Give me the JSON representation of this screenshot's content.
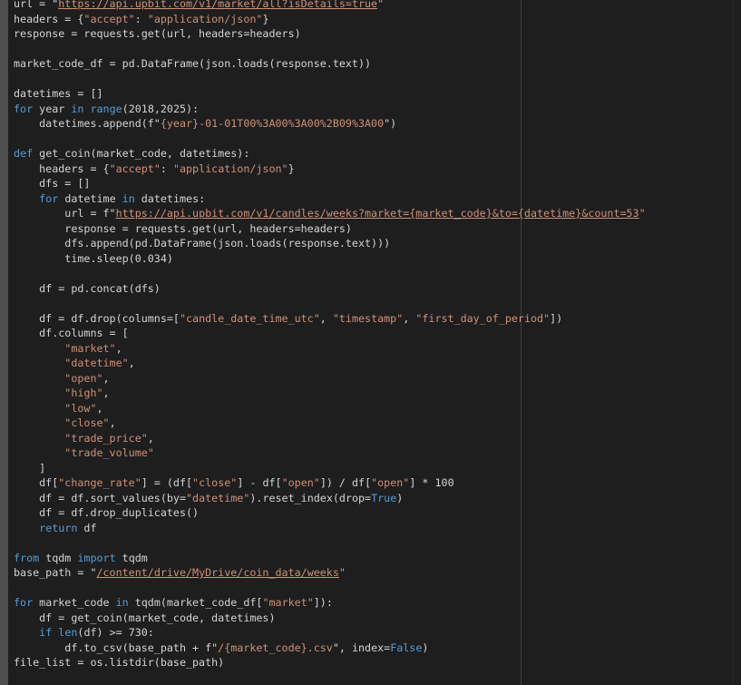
{
  "editor": {
    "lines": [
      [
        {
          "t": "url = \"",
          "c": ""
        },
        {
          "t": "https://api.upbit.com/v1/market/all?isDetails=true",
          "c": "url"
        },
        {
          "t": "\"",
          "c": "str"
        }
      ],
      [
        {
          "t": "headers = {",
          "c": ""
        },
        {
          "t": "\"accept\"",
          "c": "str"
        },
        {
          "t": ": ",
          "c": ""
        },
        {
          "t": "\"application/json\"",
          "c": "str"
        },
        {
          "t": "}",
          "c": ""
        }
      ],
      [
        {
          "t": "response = requests.get(url, headers=headers)",
          "c": ""
        }
      ],
      [],
      [
        {
          "t": "market_code_df = pd.DataFrame(json.loads(response.text))",
          "c": ""
        }
      ],
      [],
      [
        {
          "t": "datetimes = []",
          "c": ""
        }
      ],
      [
        {
          "t": "for",
          "c": "kw"
        },
        {
          "t": " year ",
          "c": ""
        },
        {
          "t": "in",
          "c": "kw"
        },
        {
          "t": " ",
          "c": ""
        },
        {
          "t": "range",
          "c": "kw"
        },
        {
          "t": "(2018,2025):",
          "c": ""
        }
      ],
      [
        {
          "t": "    datetimes.append(f\"",
          "c": ""
        },
        {
          "t": "{year}-01-01T00%3A00%3A00%2B09%3A00",
          "c": "str"
        },
        {
          "t": "\")",
          "c": ""
        }
      ],
      [],
      [
        {
          "t": "def",
          "c": "kw"
        },
        {
          "t": " get_coin(market_code, datetimes):",
          "c": ""
        }
      ],
      [
        {
          "t": "    headers = {",
          "c": ""
        },
        {
          "t": "\"accept\"",
          "c": "str"
        },
        {
          "t": ": ",
          "c": ""
        },
        {
          "t": "\"application/json\"",
          "c": "str"
        },
        {
          "t": "}",
          "c": ""
        }
      ],
      [
        {
          "t": "    dfs = []",
          "c": ""
        }
      ],
      [
        {
          "t": "    ",
          "c": ""
        },
        {
          "t": "for",
          "c": "kw"
        },
        {
          "t": " datetime ",
          "c": ""
        },
        {
          "t": "in",
          "c": "kw"
        },
        {
          "t": " datetimes:",
          "c": ""
        }
      ],
      [
        {
          "t": "        url = f\"",
          "c": ""
        },
        {
          "t": "https://api.upbit.com/v1/candles/weeks?market={market_code}&to={datetime}&count=53",
          "c": "url"
        },
        {
          "t": "\"",
          "c": "str"
        }
      ],
      [
        {
          "t": "        response = requests.get(url, headers=headers)",
          "c": ""
        }
      ],
      [
        {
          "t": "        dfs.append(pd.DataFrame(json.loads(response.text)))",
          "c": ""
        }
      ],
      [
        {
          "t": "        time.sleep(0.034)",
          "c": ""
        }
      ],
      [],
      [
        {
          "t": "    df = pd.concat(dfs)",
          "c": ""
        }
      ],
      [],
      [
        {
          "t": "    df = df.drop(columns=[",
          "c": ""
        },
        {
          "t": "\"candle_date_time_utc\"",
          "c": "str"
        },
        {
          "t": ", ",
          "c": ""
        },
        {
          "t": "\"timestamp\"",
          "c": "str"
        },
        {
          "t": ", ",
          "c": ""
        },
        {
          "t": "\"first_day_of_period\"",
          "c": "str"
        },
        {
          "t": "])",
          "c": ""
        }
      ],
      [
        {
          "t": "    df.columns = [",
          "c": ""
        }
      ],
      [
        {
          "t": "        ",
          "c": ""
        },
        {
          "t": "\"market\"",
          "c": "str"
        },
        {
          "t": ",",
          "c": ""
        }
      ],
      [
        {
          "t": "        ",
          "c": ""
        },
        {
          "t": "\"datetime\"",
          "c": "str"
        },
        {
          "t": ",",
          "c": ""
        }
      ],
      [
        {
          "t": "        ",
          "c": ""
        },
        {
          "t": "\"open\"",
          "c": "str"
        },
        {
          "t": ",",
          "c": ""
        }
      ],
      [
        {
          "t": "        ",
          "c": ""
        },
        {
          "t": "\"high\"",
          "c": "str"
        },
        {
          "t": ",",
          "c": ""
        }
      ],
      [
        {
          "t": "        ",
          "c": ""
        },
        {
          "t": "\"low\"",
          "c": "str"
        },
        {
          "t": ",",
          "c": ""
        }
      ],
      [
        {
          "t": "        ",
          "c": ""
        },
        {
          "t": "\"close\"",
          "c": "str"
        },
        {
          "t": ",",
          "c": ""
        }
      ],
      [
        {
          "t": "        ",
          "c": ""
        },
        {
          "t": "\"trade_price\"",
          "c": "str"
        },
        {
          "t": ",",
          "c": ""
        }
      ],
      [
        {
          "t": "        ",
          "c": ""
        },
        {
          "t": "\"trade_volume\"",
          "c": "str"
        }
      ],
      [
        {
          "t": "    ]",
          "c": ""
        }
      ],
      [
        {
          "t": "    df[",
          "c": ""
        },
        {
          "t": "\"change_rate\"",
          "c": "str"
        },
        {
          "t": "] = (df[",
          "c": ""
        },
        {
          "t": "\"close\"",
          "c": "str"
        },
        {
          "t": "] - df[",
          "c": ""
        },
        {
          "t": "\"open\"",
          "c": "str"
        },
        {
          "t": "]) / df[",
          "c": ""
        },
        {
          "t": "\"open\"",
          "c": "str"
        },
        {
          "t": "] * 100",
          "c": ""
        }
      ],
      [
        {
          "t": "    df = df.sort_values(by=",
          "c": ""
        },
        {
          "t": "\"datetime\"",
          "c": "str"
        },
        {
          "t": ").reset_index(drop=",
          "c": ""
        },
        {
          "t": "True",
          "c": "kw"
        },
        {
          "t": ")",
          "c": ""
        }
      ],
      [
        {
          "t": "    df = df.drop_duplicates()",
          "c": ""
        }
      ],
      [
        {
          "t": "    ",
          "c": ""
        },
        {
          "t": "return",
          "c": "kw"
        },
        {
          "t": " df",
          "c": ""
        }
      ],
      [],
      [
        {
          "t": "from",
          "c": "kw"
        },
        {
          "t": " tqdm ",
          "c": ""
        },
        {
          "t": "import",
          "c": "kw"
        },
        {
          "t": " tqdm",
          "c": ""
        }
      ],
      [
        {
          "t": "base_path = \"",
          "c": ""
        },
        {
          "t": "/content/drive/MyDrive/coin_data/weeks",
          "c": "url"
        },
        {
          "t": "\"",
          "c": "str"
        }
      ],
      [],
      [
        {
          "t": "for",
          "c": "kw"
        },
        {
          "t": " market_code ",
          "c": ""
        },
        {
          "t": "in",
          "c": "kw"
        },
        {
          "t": " tqdm(market_code_df[",
          "c": ""
        },
        {
          "t": "\"market\"",
          "c": "str"
        },
        {
          "t": "]):",
          "c": ""
        }
      ],
      [
        {
          "t": "    df = get_coin(market_code, datetimes)",
          "c": ""
        }
      ],
      [
        {
          "t": "    ",
          "c": ""
        },
        {
          "t": "if",
          "c": "kw"
        },
        {
          "t": " ",
          "c": ""
        },
        {
          "t": "len",
          "c": "kw"
        },
        {
          "t": "(df) >= 730:",
          "c": ""
        }
      ],
      [
        {
          "t": "        df.to_csv(base_path + f\"",
          "c": ""
        },
        {
          "t": "/{market_code}.csv",
          "c": "str"
        },
        {
          "t": "\", index=",
          "c": ""
        },
        {
          "t": "False",
          "c": "kw"
        },
        {
          "t": ")",
          "c": ""
        }
      ],
      [
        {
          "t": "file_list = os.listdir(base_path)",
          "c": ""
        }
      ]
    ]
  }
}
